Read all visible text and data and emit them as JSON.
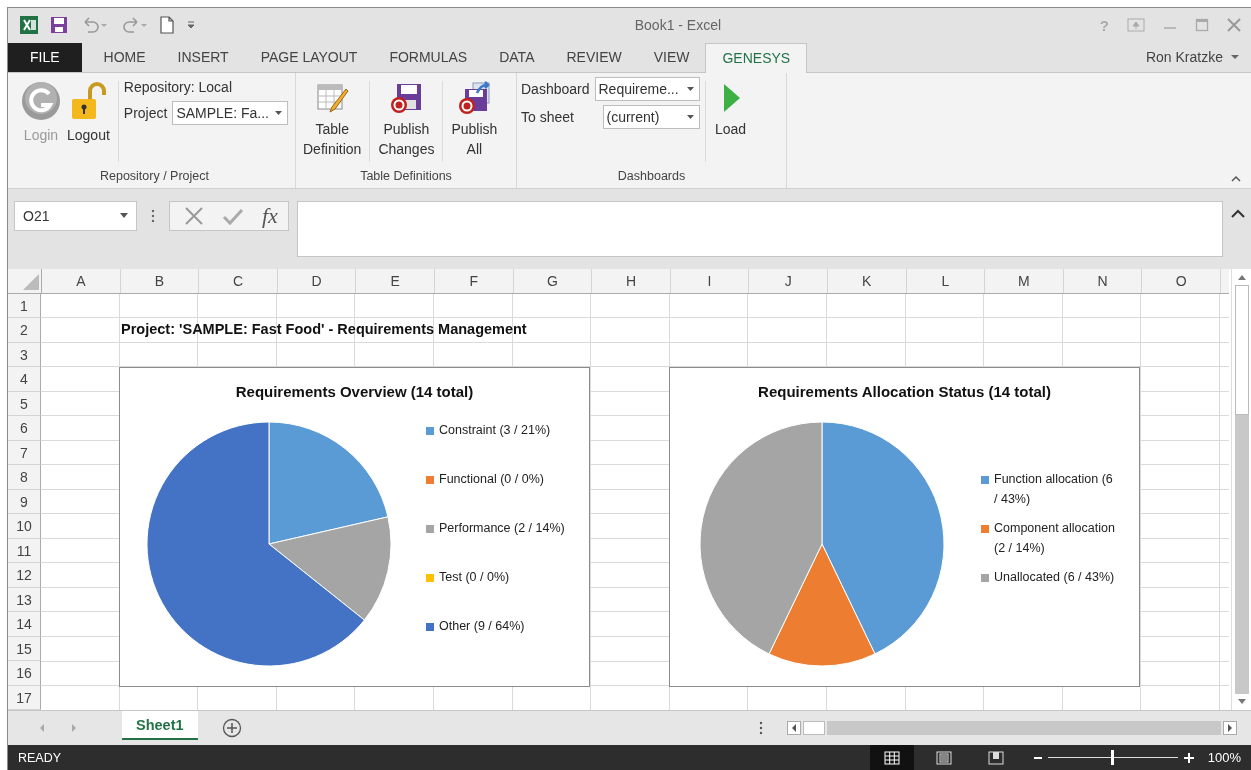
{
  "window": {
    "title": "Book1 - Excel",
    "help": "?"
  },
  "account": {
    "user": "Ron Kratzke"
  },
  "tabs": [
    {
      "label": "FILE",
      "kind": "file",
      "selected": false
    },
    {
      "label": "HOME",
      "kind": "tab",
      "selected": false
    },
    {
      "label": "INSERT",
      "kind": "tab",
      "selected": false
    },
    {
      "label": "PAGE LAYOUT",
      "kind": "tab",
      "selected": false
    },
    {
      "label": "FORMULAS",
      "kind": "tab",
      "selected": false
    },
    {
      "label": "DATA",
      "kind": "tab",
      "selected": false
    },
    {
      "label": "REVIEW",
      "kind": "tab",
      "selected": false
    },
    {
      "label": "VIEW",
      "kind": "tab",
      "selected": false
    },
    {
      "label": "GENESYS",
      "kind": "tab",
      "selected": true
    }
  ],
  "ribbon": {
    "repository_group": {
      "label": "Repository / Project",
      "login": {
        "label": "Login",
        "disabled": true
      },
      "logout": {
        "label": "Logout",
        "disabled": false
      },
      "repository": "Repository: Local",
      "project": {
        "label": "Project",
        "value": "SAMPLE: Fa..."
      }
    },
    "tables_group": {
      "label": "Table Definitions",
      "buttons": [
        {
          "kind": "table",
          "lines": [
            "Table",
            "Definition"
          ]
        },
        {
          "kind": "publish",
          "lines": [
            "Publish",
            "Changes"
          ]
        },
        {
          "kind": "publish_all",
          "lines": [
            "Publish",
            "All"
          ]
        }
      ]
    },
    "dashboards_group": {
      "label": "Dashboards",
      "dashboard": {
        "label": "Dashboard",
        "value": "Requireme..."
      },
      "to_sheet": {
        "label": "To sheet",
        "value": "(current)"
      },
      "load": {
        "label": "Load"
      }
    }
  },
  "formula_bar": {
    "name_box": "O21",
    "function_glyph": "fx"
  },
  "sheet": {
    "columns": [
      "A",
      "B",
      "C",
      "D",
      "E",
      "F",
      "G",
      "H",
      "I",
      "J",
      "K",
      "L",
      "M",
      "N",
      "O"
    ],
    "rows": [
      "1",
      "2",
      "3",
      "4",
      "5",
      "6",
      "7",
      "8",
      "9",
      "10",
      "11",
      "12",
      "13",
      "14",
      "15",
      "16",
      "17"
    ],
    "title_cell": "Project: 'SAMPLE: Fast Food' - Requirements Management",
    "charts": [
      {
        "chart_data": {
          "type": "pie",
          "legend": "right",
          "title": "Requirements Overview (14 total)",
          "categories": [
            "Constraint (3 / 21%)",
            "Functional (0 / 0%)",
            "Performance (2 / 14%)",
            "Test (0 / 0%)",
            "Other (9 / 64%)"
          ],
          "values": [
            3,
            0,
            2,
            0,
            9
          ],
          "colors": [
            "#5b9bd5",
            "#ed7d31",
            "#a5a5a5",
            "#ffc000",
            "#4472c4"
          ]
        }
      },
      {
        "chart_data": {
          "type": "pie",
          "legend": "right",
          "title": "Requirements Allocation Status (14 total)",
          "categories": [
            "Function allocation (6 / 43%)",
            "Component allocation (2 / 14%)",
            "Unallocated (6 / 43%)"
          ],
          "values": [
            6,
            2,
            6
          ],
          "colors": [
            "#5b9bd5",
            "#ed7d31",
            "#a5a5a5"
          ]
        }
      }
    ]
  },
  "sheet_tabs": [
    {
      "label": "Sheet1",
      "selected": true
    }
  ],
  "status_bar": {
    "mode": "READY",
    "views": [
      {
        "kind": "normal",
        "selected": true
      },
      {
        "kind": "page_layout",
        "selected": false
      },
      {
        "kind": "page_break",
        "selected": false
      }
    ],
    "zoom": {
      "level": 0.5
    },
    "zoom_label": "100%"
  }
}
